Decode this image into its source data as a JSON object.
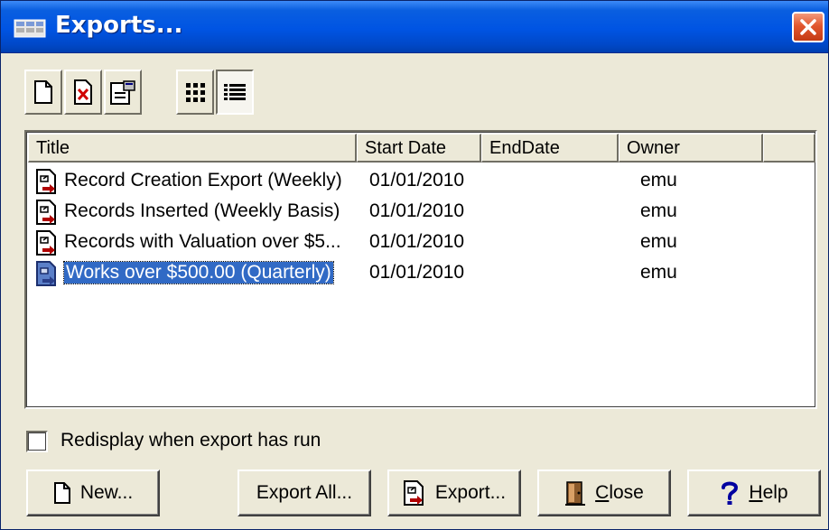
{
  "window": {
    "title": "Exports..."
  },
  "toolbar": {
    "buttons": [
      {
        "name": "new-document-button",
        "icon": "new-document-icon"
      },
      {
        "name": "delete-button",
        "icon": "delete-icon"
      },
      {
        "name": "properties-button",
        "icon": "properties-icon"
      },
      {
        "name": "icon-view-button",
        "icon": "large-icons-view-icon"
      },
      {
        "name": "details-view-button",
        "icon": "details-view-icon",
        "pressed": true
      }
    ]
  },
  "list": {
    "columns": [
      "Title",
      "Start Date",
      "EndDate",
      "Owner"
    ],
    "rows": [
      {
        "title": "Record Creation Export (Weekly)",
        "start": "01/01/2010",
        "end": "",
        "owner": "emu",
        "icon": "export-doc-icon",
        "selected": false
      },
      {
        "title": "Records Inserted (Weekly Basis)",
        "start": "01/01/2010",
        "end": "",
        "owner": "emu",
        "icon": "export-doc-icon",
        "selected": false
      },
      {
        "title": "Records with Valuation over $5...",
        "start": "01/01/2010",
        "end": "",
        "owner": "emu",
        "icon": "export-doc-icon",
        "selected": false
      },
      {
        "title": "Works over $500.00 (Quarterly)",
        "start": "01/01/2010",
        "end": "",
        "owner": "emu",
        "icon": "export-doc-icon",
        "selected": true
      }
    ]
  },
  "options": {
    "redisplay_label": "Redisplay when export has run",
    "redisplay_checked": false
  },
  "buttons": {
    "new": "New...",
    "export_all": "Export All...",
    "export": "Export...",
    "close_mnemonic": "C",
    "close_rest": "lose",
    "help_mnemonic": "H",
    "help_rest": "elp"
  },
  "colors": {
    "titlebar": "#0054e3",
    "selection": "#316ac5",
    "face": "#ece9d8"
  }
}
